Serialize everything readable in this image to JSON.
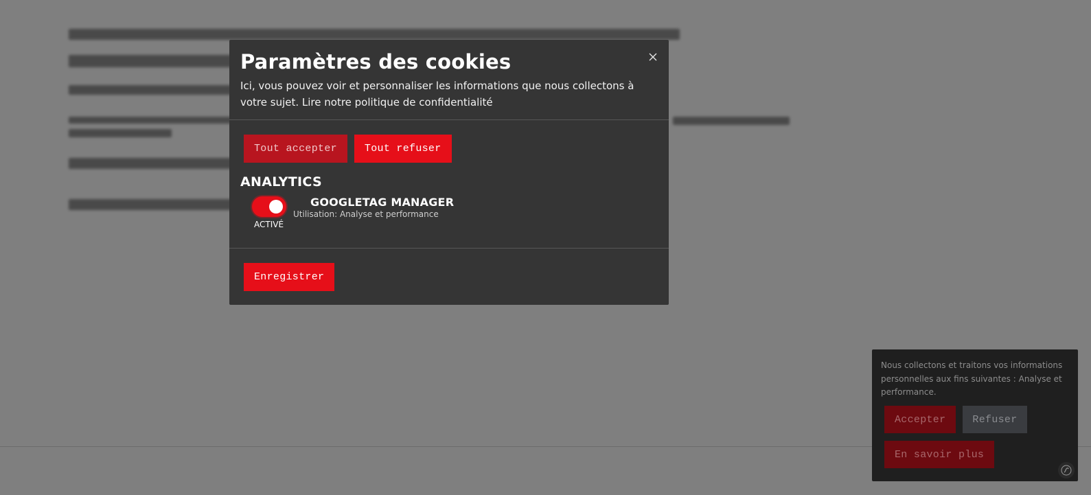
{
  "modal": {
    "title": "Paramètres des cookies",
    "description": "Ici, vous pouvez voir et personnaliser les informations que nous collectons à votre sujet. Lire notre politique de confidentialité",
    "close_icon": "close-icon",
    "accept_all_label": "Tout accepter",
    "refuse_all_label": "Tout refuser",
    "section_title": "ANALYTICS",
    "service": {
      "name": "GOOGLETAG MANAGER",
      "usage": "Utilisation: Analyse et performance",
      "toggle_state_label": "ACTIVÉ",
      "enabled": true
    },
    "save_label": "Enregistrer"
  },
  "banner": {
    "text": "Nous collectons et traitons vos informations personnelles aux fins suivantes : Analyse et performance.",
    "accept_label": "Accepter",
    "refuse_label": "Refuser",
    "learn_more_label": "En savoir plus"
  },
  "colors": {
    "accent": "#e60f19",
    "modal_bg": "#353535",
    "banner_bg": "#1f1f1f"
  }
}
